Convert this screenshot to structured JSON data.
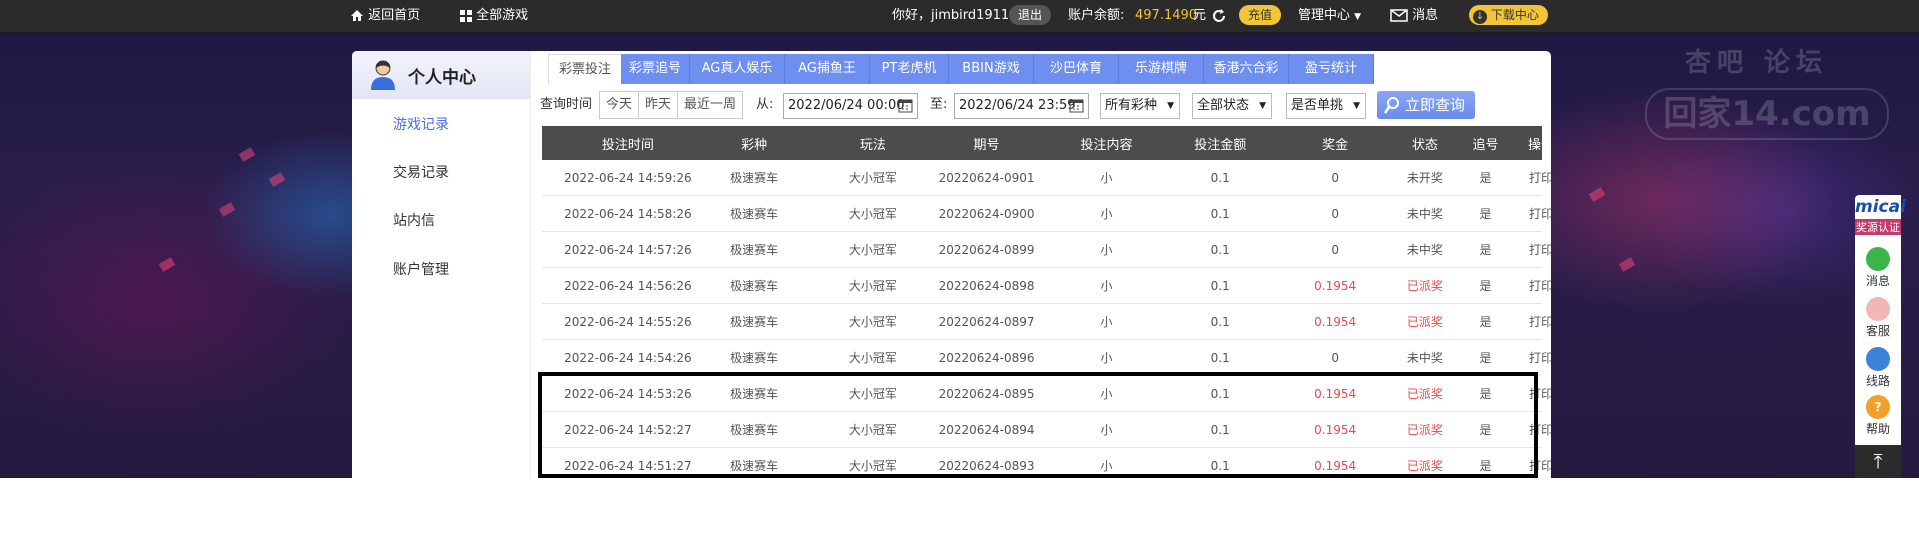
{
  "topbar": {
    "home": "返回首页",
    "all_games": "全部游戏",
    "greeting": "你好，jimbird1911",
    "logout": "退出",
    "balance_label": "账户余额:",
    "balance_value": "497.1490",
    "balance_unit": "元",
    "recharge": "充值",
    "manage": "管理中心",
    "messages": "消息",
    "download": "下载中心"
  },
  "watermark": {
    "top": "杏吧    论坛",
    "main": "回家14.com"
  },
  "sidebar": {
    "title": "个人中心",
    "items": [
      {
        "label": "游戏记录",
        "active": true
      },
      {
        "label": "交易记录"
      },
      {
        "label": "站内信"
      },
      {
        "label": "账户管理"
      }
    ]
  },
  "tabs": [
    "彩票投注",
    "彩票追号",
    "AG真人娱乐",
    "AG捕鱼王",
    "PT老虎机",
    "BBIN游戏",
    "沙巴体育",
    "乐游棋牌",
    "香港六合彩",
    "盈亏统计"
  ],
  "filters": {
    "label": "查询时间",
    "quick": [
      "今天",
      "昨天",
      "最近一周"
    ],
    "from_label": "从:",
    "from_value": "2022/06/24 00:00",
    "to_label": "至:",
    "to_value": "2022/06/24 23:59",
    "lottery_select": "所有彩种",
    "status_select": "全部状态",
    "single_select": "是否单挑",
    "query_button": "立即查询"
  },
  "table": {
    "headers": [
      "投注时间",
      "彩种",
      "玩法",
      "期号",
      "投注内容",
      "投注金额",
      "奖金",
      "状态",
      "追号",
      "操作"
    ],
    "rows": [
      [
        "2022-06-24 14:59:26",
        "极速赛车",
        "大小冠军",
        "20220624-0901",
        "小",
        "0.1",
        "0",
        "未开奖",
        "是",
        "打印"
      ],
      [
        "2022-06-24 14:58:26",
        "极速赛车",
        "大小冠军",
        "20220624-0900",
        "小",
        "0.1",
        "0",
        "未中奖",
        "是",
        "打印"
      ],
      [
        "2022-06-24 14:57:26",
        "极速赛车",
        "大小冠军",
        "20220624-0899",
        "小",
        "0.1",
        "0",
        "未中奖",
        "是",
        "打印"
      ],
      [
        "2022-06-24 14:56:26",
        "极速赛车",
        "大小冠军",
        "20220624-0898",
        "小",
        "0.1",
        "0.1954",
        "已派奖",
        "是",
        "打印"
      ],
      [
        "2022-06-24 14:55:26",
        "极速赛车",
        "大小冠军",
        "20220624-0897",
        "小",
        "0.1",
        "0.1954",
        "已派奖",
        "是",
        "打印"
      ],
      [
        "2022-06-24 14:54:26",
        "极速赛车",
        "大小冠军",
        "20220624-0896",
        "小",
        "0.1",
        "0",
        "未中奖",
        "是",
        "打印"
      ],
      [
        "2022-06-24 14:53:26",
        "极速赛车",
        "大小冠军",
        "20220624-0895",
        "小",
        "0.1",
        "0.1954",
        "已派奖",
        "是",
        "打印"
      ],
      [
        "2022-06-24 14:52:27",
        "极速赛车",
        "大小冠军",
        "20220624-0894",
        "小",
        "0.1",
        "0.1954",
        "已派奖",
        "是",
        "打印"
      ],
      [
        "2022-06-24 14:51:27",
        "极速赛车",
        "大小冠军",
        "20220624-0893",
        "小",
        "0.1",
        "0.1954",
        "已派奖",
        "是",
        "打印"
      ]
    ]
  },
  "rightbar": {
    "logo": "micai",
    "badge": "奖源认证",
    "items": [
      "消息",
      "客服",
      "线路",
      "帮助"
    ]
  },
  "colors": {
    "accent": "#6e8ef0",
    "win_red": "#e84a4a",
    "balance_yellow": "#f3c436"
  }
}
